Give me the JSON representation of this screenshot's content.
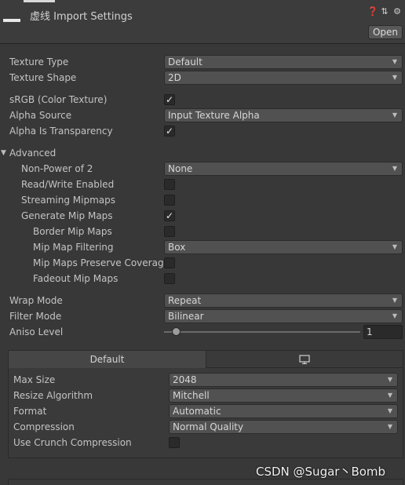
{
  "header": {
    "title": "虚线 Import Settings",
    "open_label": "Open",
    "icons": [
      "help-icon",
      "preset-icon",
      "gear-icon"
    ]
  },
  "fields": {
    "texture_type": {
      "label": "Texture Type",
      "value": "Default"
    },
    "texture_shape": {
      "label": "Texture Shape",
      "value": "2D"
    },
    "srgb": {
      "label": "sRGB (Color Texture)",
      "checked": true,
      "mark": "✓"
    },
    "alpha_source": {
      "label": "Alpha Source",
      "value": "Input Texture Alpha"
    },
    "alpha_transparency": {
      "label": "Alpha Is Transparency",
      "checked": true,
      "mark": "✓"
    },
    "advanced": {
      "label": "Advanced",
      "expanded": true
    },
    "npot": {
      "label": "Non-Power of 2",
      "value": "None"
    },
    "read_write": {
      "label": "Read/Write Enabled",
      "checked": false
    },
    "streaming": {
      "label": "Streaming Mipmaps",
      "checked": false
    },
    "gen_mips": {
      "label": "Generate Mip Maps",
      "checked": true,
      "mark": "✓"
    },
    "border_mips": {
      "label": "Border Mip Maps",
      "checked": false
    },
    "mip_filter": {
      "label": "Mip Map Filtering",
      "value": "Box"
    },
    "preserve_cov": {
      "label": "Mip Maps Preserve Coverage",
      "checked": false
    },
    "fadeout": {
      "label": "Fadeout Mip Maps",
      "checked": false
    },
    "wrap_mode": {
      "label": "Wrap Mode",
      "value": "Repeat"
    },
    "filter_mode": {
      "label": "Filter Mode",
      "value": "Bilinear"
    },
    "aniso": {
      "label": "Aniso Level",
      "value": "1",
      "slider_fraction": 0.06
    }
  },
  "platform": {
    "tab_default": "Default",
    "tab_standalone_icon": "monitor-icon",
    "max_size": {
      "label": "Max Size",
      "value": "2048"
    },
    "resize": {
      "label": "Resize Algorithm",
      "value": "Mitchell"
    },
    "format": {
      "label": "Format",
      "value": "Automatic"
    },
    "compression": {
      "label": "Compression",
      "value": "Normal Quality"
    },
    "crunch": {
      "label": "Use Crunch Compression",
      "checked": false
    }
  },
  "watermark": "CSDN @Sugar丶Bomb",
  "colors": {
    "background": "#383838",
    "field": "#515151",
    "text": "#c4c4c4"
  }
}
